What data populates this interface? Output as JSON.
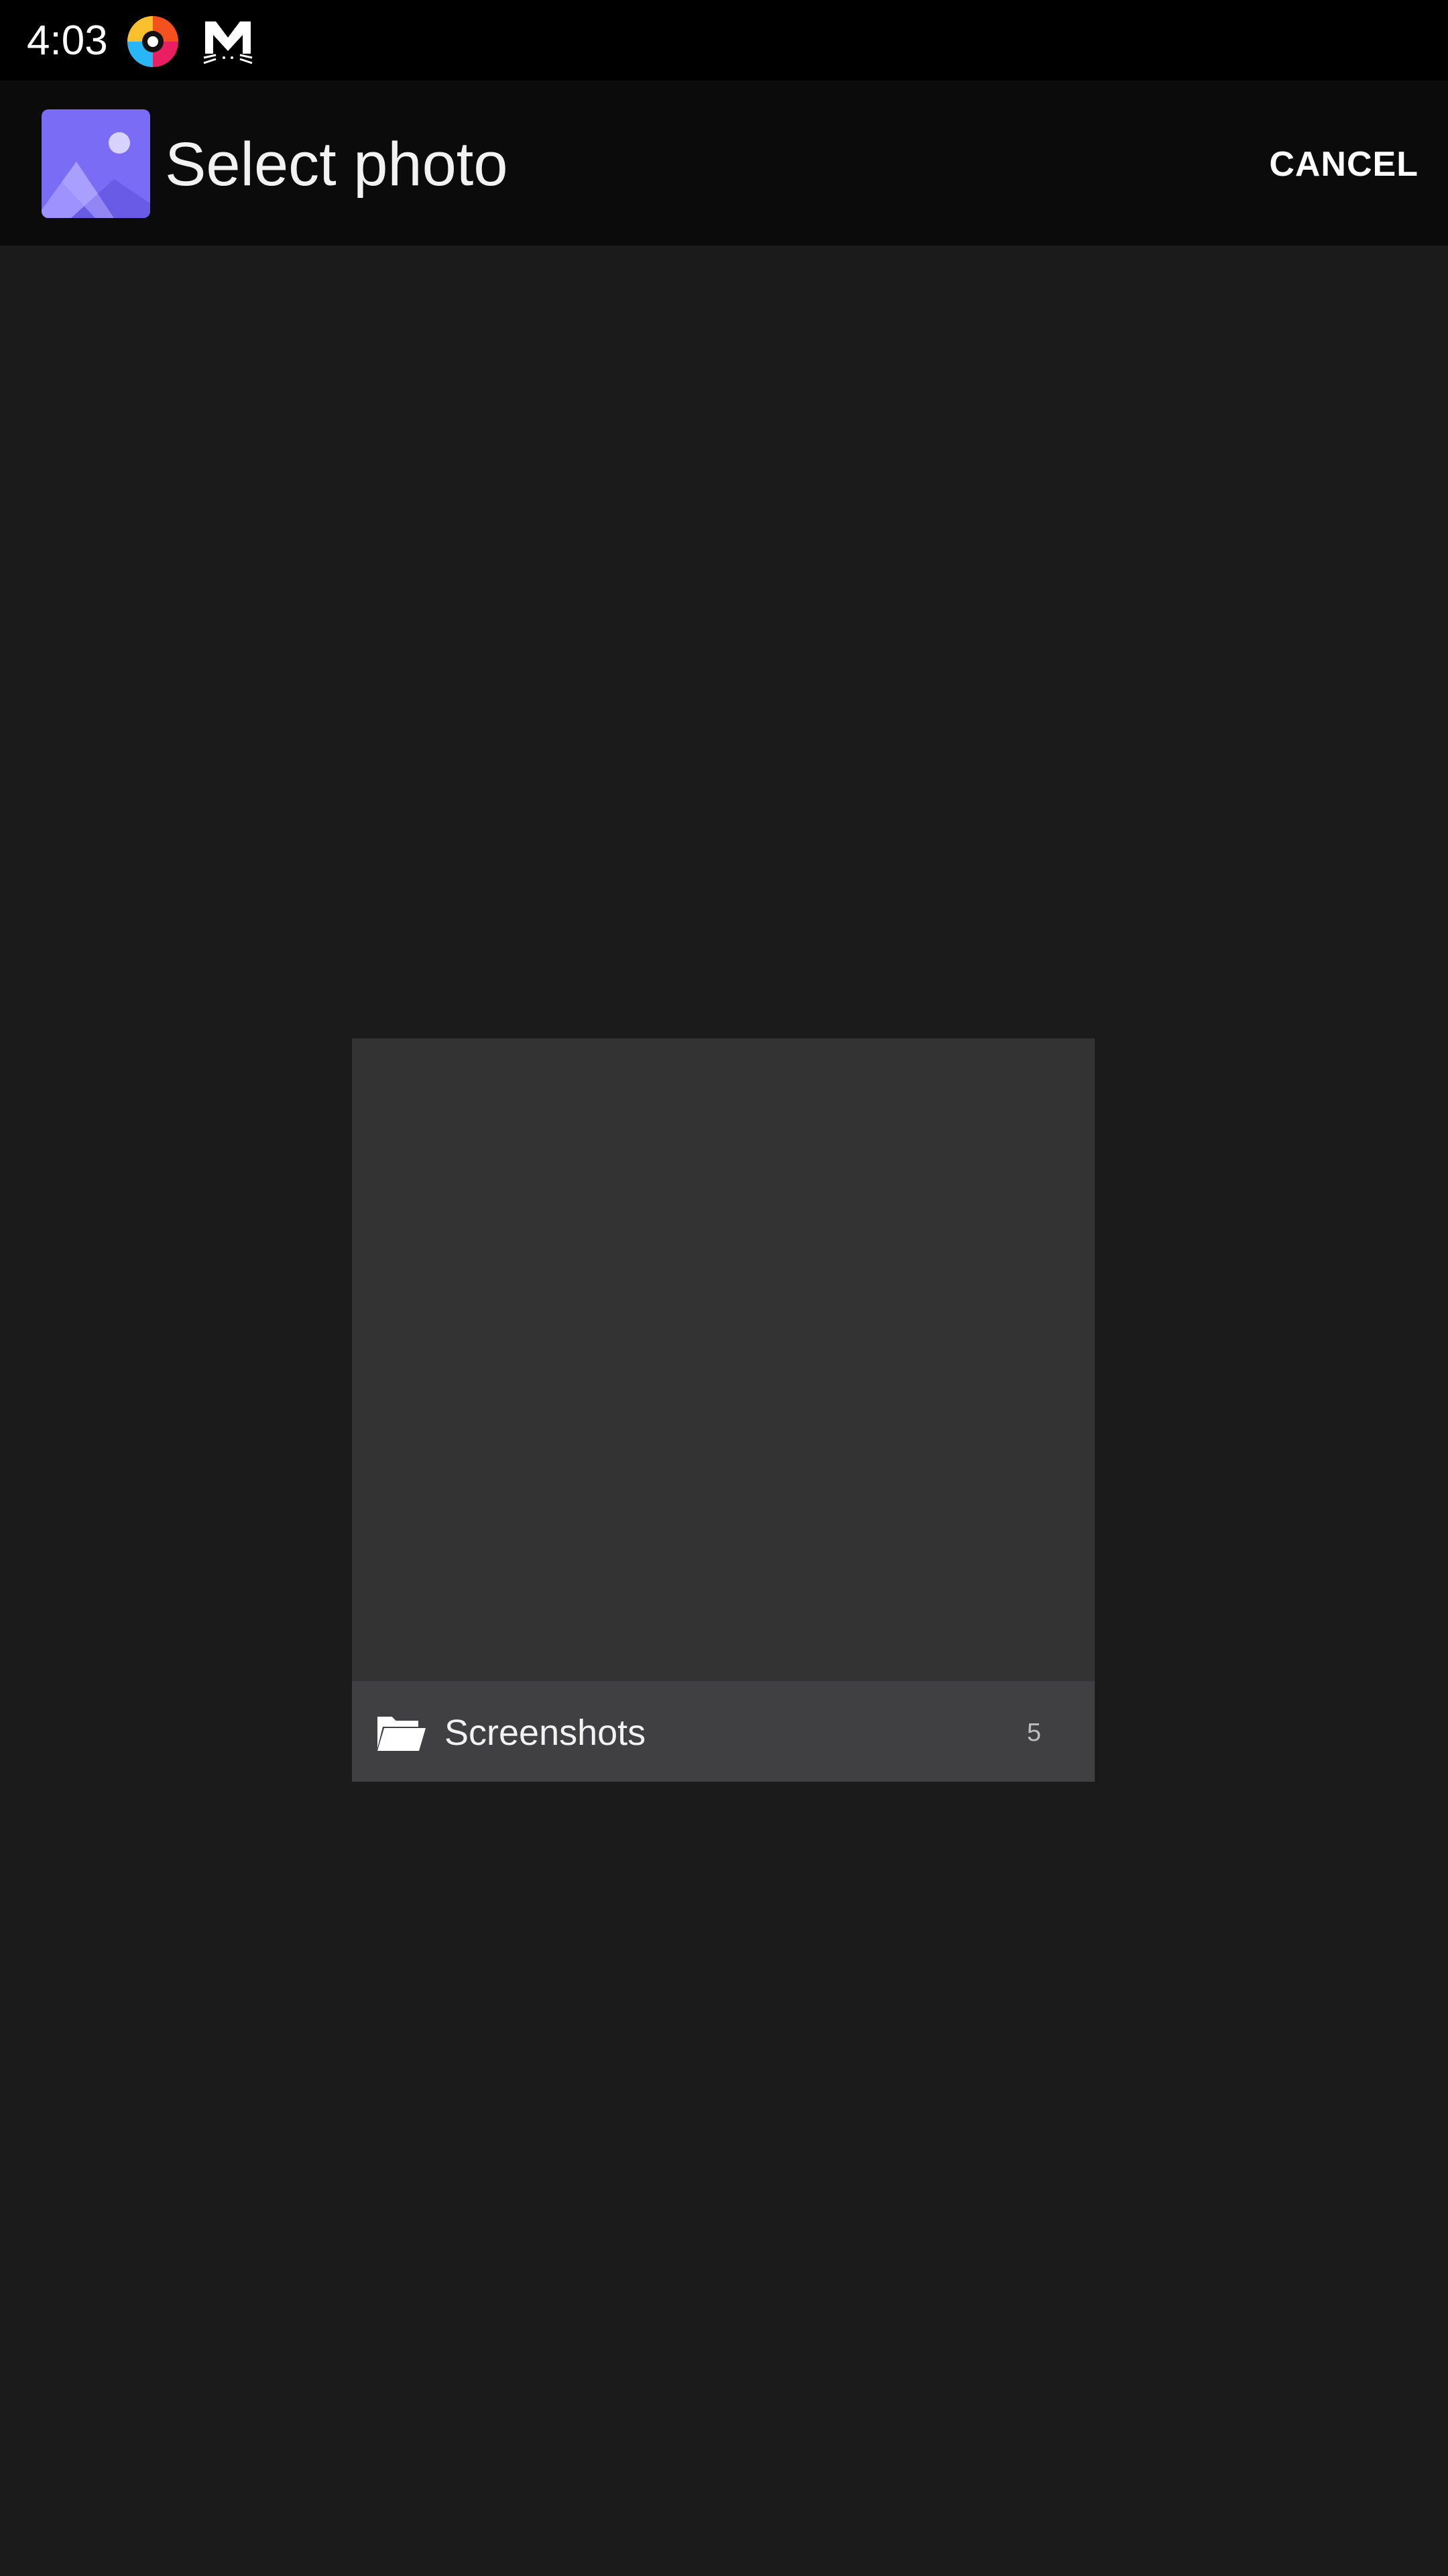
{
  "status_bar": {
    "time": "4:03",
    "icons": [
      "browser-app-icon",
      "mail-cat-icon"
    ]
  },
  "app_bar": {
    "title": "Select photo",
    "icon": "photo-gallery-icon",
    "cancel_label": "CANCEL"
  },
  "albums": [
    {
      "name": "Screenshots",
      "count": "5",
      "icon": "folder-open-icon"
    }
  ],
  "colors": {
    "background": "#1b1b1b",
    "app_bar": "#0b0b0b",
    "status_bar": "#000000",
    "tile": "#333333",
    "tile_footer": "#404042",
    "app_icon_accent": "#7b6cf6"
  }
}
